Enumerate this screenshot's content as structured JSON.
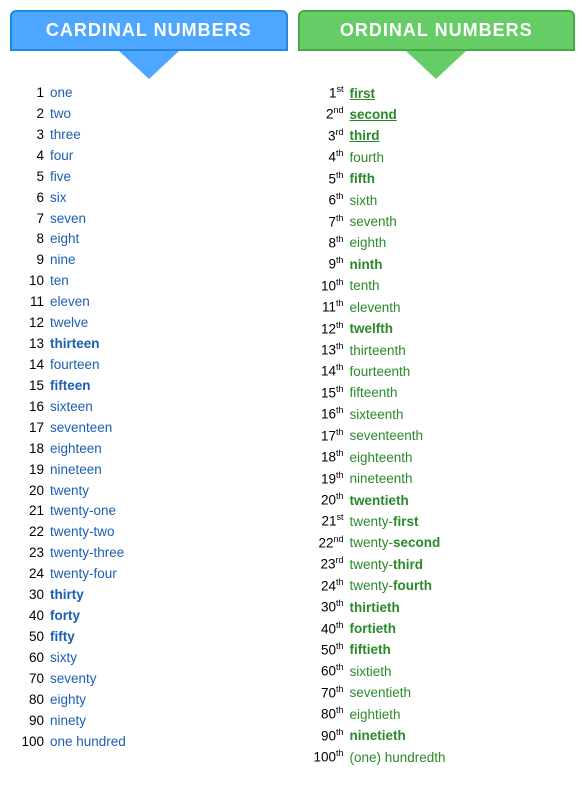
{
  "headers": {
    "cardinal": "CARDINAL NUMBERS",
    "ordinal": "ORDINAL NUMBERS"
  },
  "cardinal_rows": [
    {
      "num": "1",
      "word": "one",
      "bold": false
    },
    {
      "num": "2",
      "word": "two",
      "bold": false
    },
    {
      "num": "3",
      "word": "three",
      "bold": false
    },
    {
      "num": "4",
      "word": "four",
      "bold": false
    },
    {
      "num": "5",
      "word": "five",
      "bold": false
    },
    {
      "num": "6",
      "word": "six",
      "bold": false
    },
    {
      "num": "7",
      "word": "seven",
      "bold": false
    },
    {
      "num": "8",
      "word": "eight",
      "bold": false
    },
    {
      "num": "9",
      "word": "nine",
      "bold": false
    },
    {
      "num": "10",
      "word": "ten",
      "bold": false
    },
    {
      "num": "11",
      "word": "eleven",
      "bold": false
    },
    {
      "num": "12",
      "word": "twelve",
      "bold": false
    },
    {
      "num": "13",
      "word": "thirteen",
      "bold": true
    },
    {
      "num": "14",
      "word": "fourteen",
      "bold": false
    },
    {
      "num": "15",
      "word": "fifteen",
      "bold": true
    },
    {
      "num": "16",
      "word": "sixteen",
      "bold": false
    },
    {
      "num": "17",
      "word": "seventeen",
      "bold": false
    },
    {
      "num": "18",
      "word": "eighteen",
      "bold": false
    },
    {
      "num": "19",
      "word": "nineteen",
      "bold": false
    },
    {
      "num": "20",
      "word": "twenty",
      "bold": false
    },
    {
      "num": "21",
      "word": "twenty-one",
      "bold": false
    },
    {
      "num": "22",
      "word": "twenty-two",
      "bold": false
    },
    {
      "num": "23",
      "word": "twenty-three",
      "bold": false
    },
    {
      "num": "24",
      "word": "twenty-four",
      "bold": false
    },
    {
      "num": "30",
      "word": "thirty",
      "bold": true
    },
    {
      "num": "40",
      "word": "forty",
      "bold": true
    },
    {
      "num": "50",
      "word": "fifty",
      "bold": true
    },
    {
      "num": "60",
      "word": "sixty",
      "bold": false
    },
    {
      "num": "70",
      "word": "seventy",
      "bold": false
    },
    {
      "num": "80",
      "word": "eighty",
      "bold": false
    },
    {
      "num": "90",
      "word": "ninety",
      "bold": false
    },
    {
      "num": "100",
      "word": "one hundred",
      "bold": false
    }
  ],
  "ordinal_rows": [
    {
      "num": "1",
      "sup": "st",
      "word": "first",
      "style": "underline"
    },
    {
      "num": "2",
      "sup": "nd",
      "word": "second",
      "style": "underline"
    },
    {
      "num": "3",
      "sup": "rd",
      "word": "third",
      "style": "underline"
    },
    {
      "num": "4",
      "sup": "th",
      "word": "fourth",
      "style": "normal"
    },
    {
      "num": "5",
      "sup": "th",
      "word": "fifth",
      "style": "bold"
    },
    {
      "num": "6",
      "sup": "th",
      "word": "sixth",
      "style": "normal"
    },
    {
      "num": "7",
      "sup": "th",
      "word": "seventh",
      "style": "normal"
    },
    {
      "num": "8",
      "sup": "th",
      "word": "eighth",
      "style": "normal"
    },
    {
      "num": "9",
      "sup": "th",
      "word": "ninth",
      "style": "bold"
    },
    {
      "num": "10",
      "sup": "th",
      "word": "tenth",
      "style": "normal"
    },
    {
      "num": "11",
      "sup": "th",
      "word": "eleventh",
      "style": "normal"
    },
    {
      "num": "12",
      "sup": "th",
      "word": "twelfth",
      "style": "bold"
    },
    {
      "num": "13",
      "sup": "th",
      "word": "thirteenth",
      "style": "normal"
    },
    {
      "num": "14",
      "sup": "th",
      "word": "fourteenth",
      "style": "normal"
    },
    {
      "num": "15",
      "sup": "th",
      "word": "fifteenth",
      "style": "normal"
    },
    {
      "num": "16",
      "sup": "th",
      "word": "sixteenth",
      "style": "normal"
    },
    {
      "num": "17",
      "sup": "th",
      "word": "seventeenth",
      "style": "normal"
    },
    {
      "num": "18",
      "sup": "th",
      "word": "eighteenth",
      "style": "normal"
    },
    {
      "num": "19",
      "sup": "th",
      "word": "nineteenth",
      "style": "normal"
    },
    {
      "num": "20",
      "sup": "th",
      "word": "twentieth",
      "style": "bold"
    },
    {
      "num": "21",
      "sup": "st",
      "word": "twenty-first",
      "style": "partial-bold",
      "bold_start": 7
    },
    {
      "num": "22",
      "sup": "nd",
      "word": "twenty-second",
      "style": "partial-bold",
      "bold_start": 7
    },
    {
      "num": "23",
      "sup": "rd",
      "word": "twenty-third",
      "style": "partial-bold",
      "bold_start": 7
    },
    {
      "num": "24",
      "sup": "th",
      "word": "twenty-fourth",
      "style": "partial-bold",
      "bold_start": 7
    },
    {
      "num": "30",
      "sup": "th",
      "word": "thirtieth",
      "style": "bold"
    },
    {
      "num": "40",
      "sup": "th",
      "word": "fortieth",
      "style": "bold"
    },
    {
      "num": "50",
      "sup": "th",
      "word": "fiftieth",
      "style": "bold"
    },
    {
      "num": "60",
      "sup": "th",
      "word": "sixtieth",
      "style": "normal"
    },
    {
      "num": "70",
      "sup": "th",
      "word": "seventieth",
      "style": "normal"
    },
    {
      "num": "80",
      "sup": "th",
      "word": "eightieth",
      "style": "normal"
    },
    {
      "num": "90",
      "sup": "th",
      "word": "ninetieth",
      "style": "bold"
    },
    {
      "num": "100",
      "sup": "th",
      "word": "(one) hundredth",
      "style": "normal"
    }
  ]
}
